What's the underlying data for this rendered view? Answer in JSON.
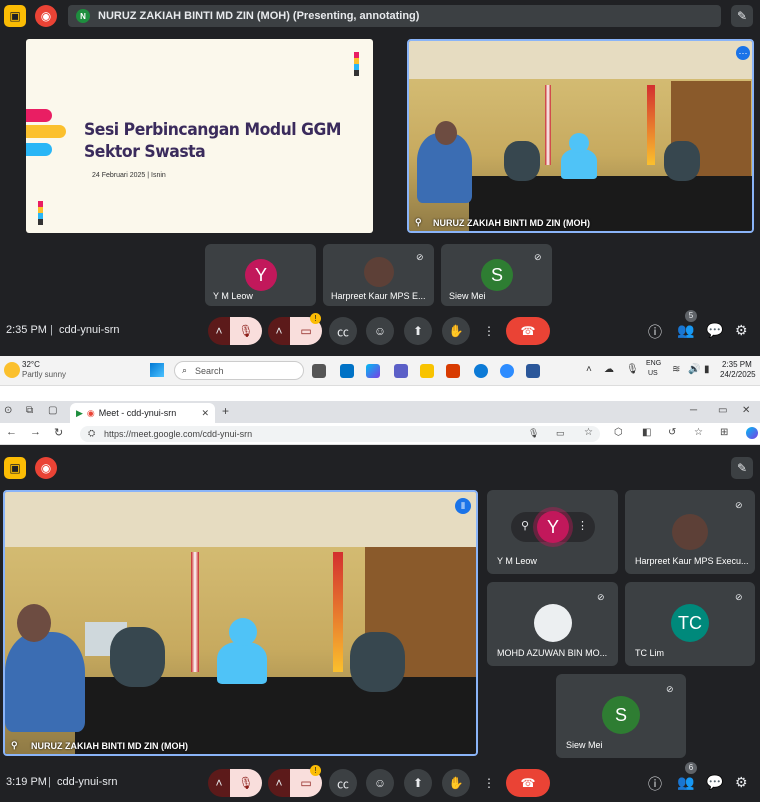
{
  "top": {
    "presenting_bar": {
      "initial": "N",
      "text": "NURUZ ZAKIAH BINTI MD ZIN (MOH) (Presenting, annotating)"
    },
    "slide": {
      "title_line1": "Sesi Perbincangan Modul GGM",
      "title_line2": "Sektor Swasta",
      "date": "24 Februari 2025 | Isnin"
    },
    "main_video_name": "NURUZ ZAKIAH BINTI MD ZIN (MOH)",
    "tiles": [
      {
        "name": "Y M Leow",
        "initial": "Y",
        "color": "#c2185b"
      },
      {
        "name": "Harpreet Kaur MPS E...",
        "initial": ""
      },
      {
        "name": "Siew Mei",
        "initial": "S",
        "color": "#2e7d32"
      }
    ],
    "time": "2:35 PM",
    "meeting_code": "cdd-ynui-srn",
    "people_count": "5"
  },
  "taskbar": {
    "weather_temp": "32°C",
    "weather_desc": "Partly sunny",
    "search_placeholder": "Search",
    "lang_line1": "ENG",
    "lang_line2": "US",
    "time": "2:35 PM",
    "date": "24/2/2025"
  },
  "browser": {
    "tab_title": "Meet - cdd-ynui-srn",
    "url": "https://meet.google.com/cdd-ynui-srn"
  },
  "bottom": {
    "main_video_name": "NURUZ ZAKIAH BINTI MD ZIN (MOH)",
    "tiles": [
      {
        "name": "Y M Leow",
        "initial": "Y",
        "color": "#c2185b"
      },
      {
        "name": "Harpreet Kaur MPS Execu...",
        "initial": ""
      },
      {
        "name": "MOHD AZUWAN BIN MO...",
        "initial": ""
      },
      {
        "name": "TC Lim",
        "initial": "TC",
        "color": "#00897b"
      },
      {
        "name": "Siew Mei",
        "initial": "S",
        "color": "#2e7d32"
      }
    ],
    "time": "3:19 PM",
    "meeting_code": "cdd-ynui-srn",
    "people_count": "6"
  }
}
